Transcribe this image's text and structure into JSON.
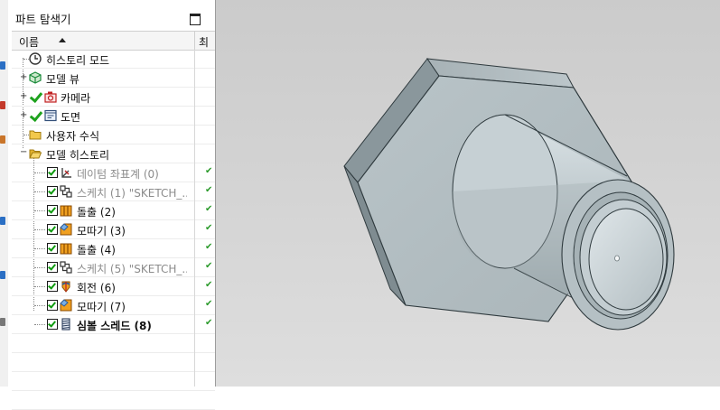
{
  "panel": {
    "title": "파트 탐색기",
    "column_name": "이름",
    "column2": "최"
  },
  "tree": [
    {
      "label": "히스토리 모드",
      "icon": "clock-icon",
      "style": "normal"
    },
    {
      "label": "모델 뷰",
      "icon": "model-views-icon",
      "style": "normal"
    },
    {
      "label": "카메라",
      "icon": "camera-icon",
      "style": "normal"
    },
    {
      "label": "도면",
      "icon": "drawing-sheet-icon",
      "style": "normal"
    },
    {
      "label": "사용자 수식",
      "icon": "folder-icon",
      "style": "normal"
    },
    {
      "label": "모델 히스토리",
      "icon": "folder-open-icon",
      "style": "normal"
    },
    {
      "label": "데이텀 좌표계 (0)",
      "icon": "datum-csys-icon",
      "style": "dim",
      "checked": true
    },
    {
      "label": "스케치 (1) \"SKETCH_...",
      "icon": "sketch-icon",
      "style": "dim",
      "checked": true
    },
    {
      "label": "돌출 (2)",
      "icon": "extrude-icon",
      "style": "normal",
      "checked": true
    },
    {
      "label": "모따기 (3)",
      "icon": "chamfer-icon",
      "style": "normal",
      "checked": true
    },
    {
      "label": "돌출 (4)",
      "icon": "extrude-icon",
      "style": "normal",
      "checked": true
    },
    {
      "label": "스케치 (5) \"SKETCH_...",
      "icon": "sketch-icon",
      "style": "dim",
      "checked": true
    },
    {
      "label": "회전 (6)",
      "icon": "revolve-icon",
      "style": "normal",
      "checked": true
    },
    {
      "label": "모따기 (7)",
      "icon": "chamfer-icon",
      "style": "normal",
      "checked": true
    },
    {
      "label": "심볼 스레드 (8)",
      "icon": "symbolic-thread-icon",
      "style": "bold",
      "checked": true
    }
  ],
  "colors": {
    "check_green": "#1ea21e",
    "model_gray": "#b9c4c8",
    "viewport_bg": "#d2d2d2"
  }
}
